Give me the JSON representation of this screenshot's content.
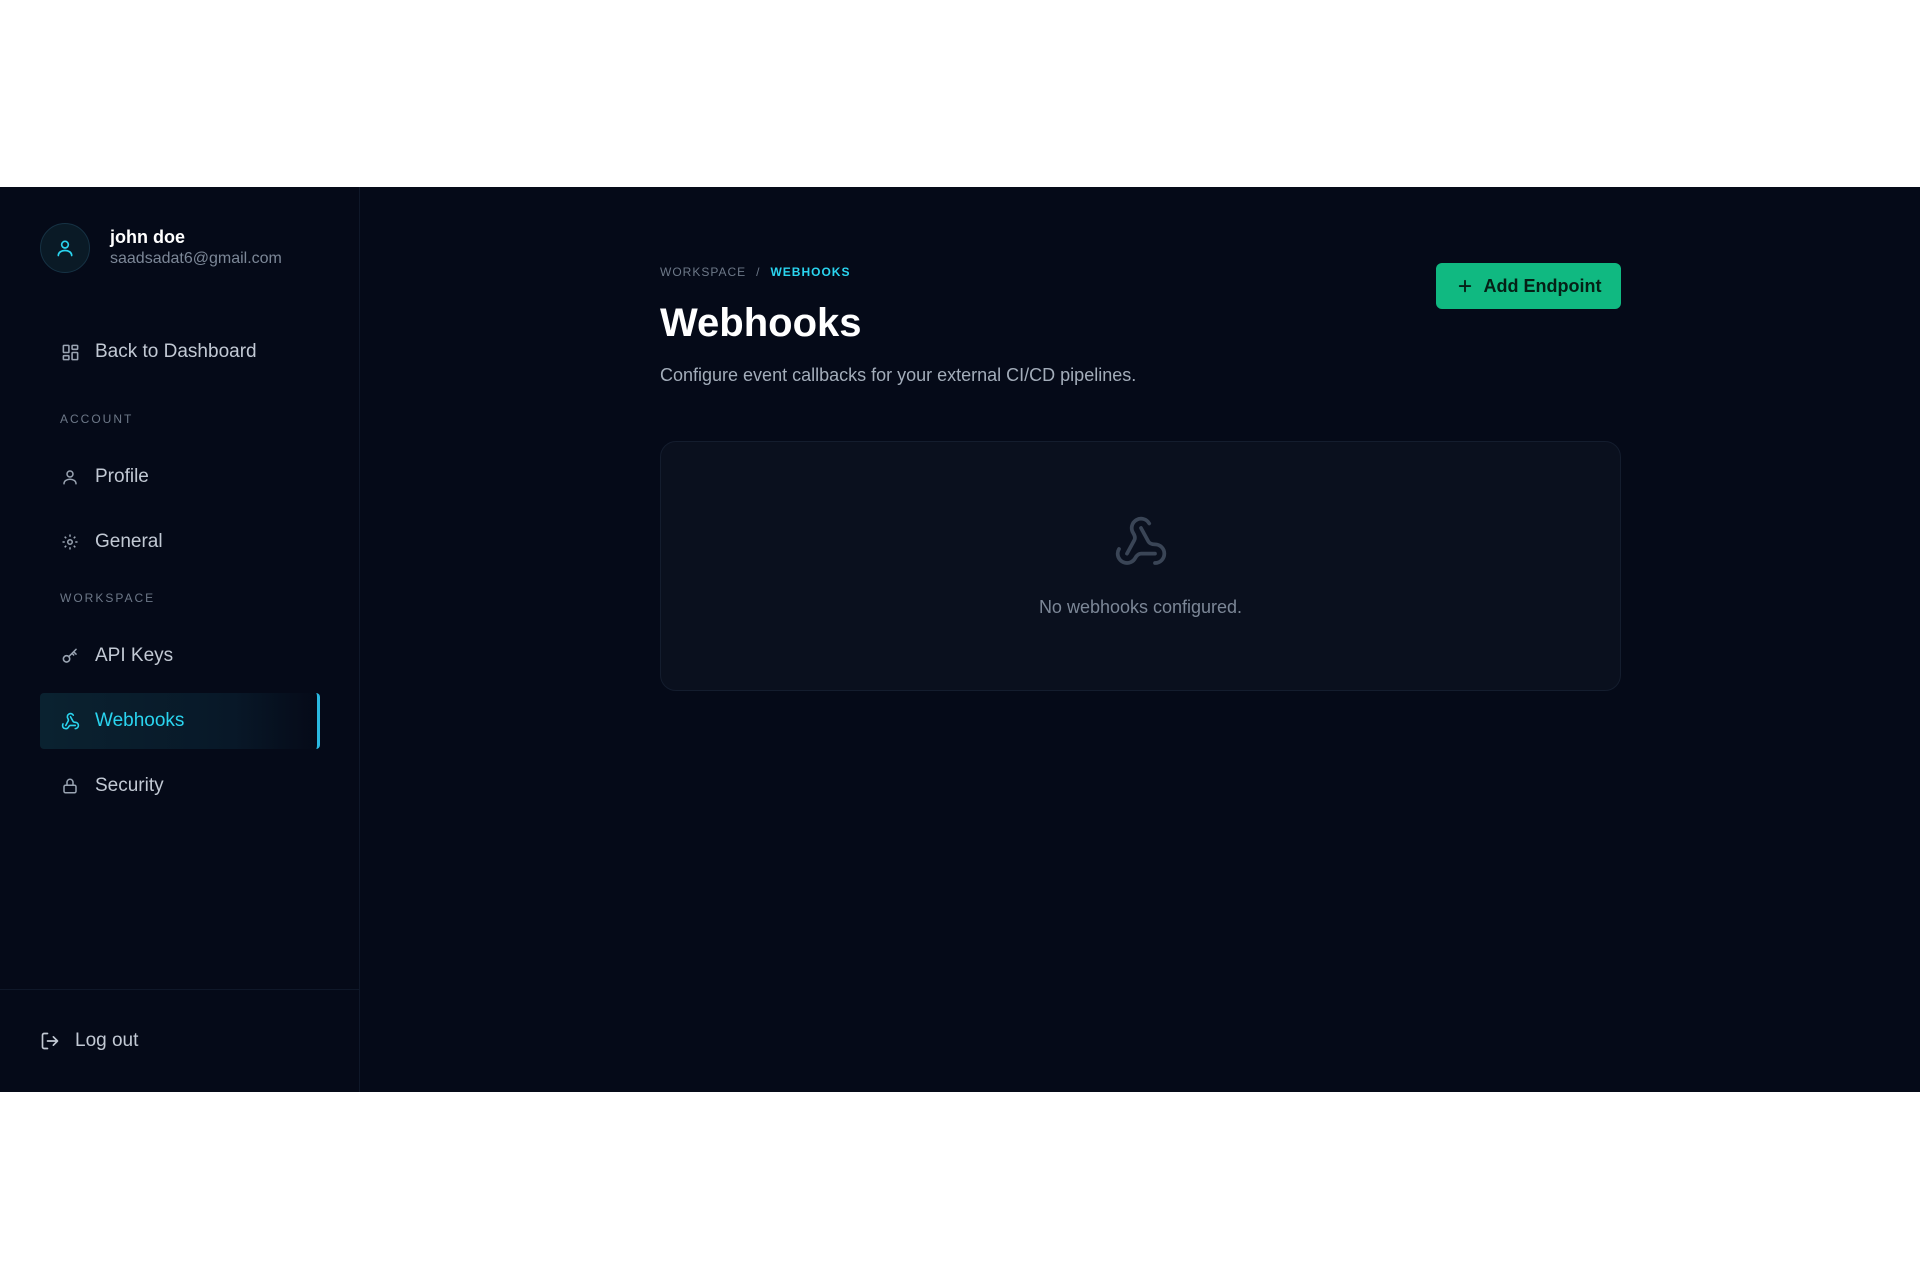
{
  "user": {
    "name": "john doe",
    "email": "saadsadat6@gmail.com"
  },
  "sidebar": {
    "back_label": "Back to Dashboard",
    "sections": {
      "account": "ACCOUNT",
      "workspace": "WORKSPACE"
    },
    "items": {
      "profile": "Profile",
      "general": "General",
      "api_keys": "API Keys",
      "webhooks": "Webhooks",
      "security": "Security"
    },
    "logout_label": "Log out"
  },
  "breadcrumb": {
    "root": "WORKSPACE",
    "separator": "/",
    "current": "WEBHOOKS"
  },
  "page": {
    "title": "Webhooks",
    "subtitle": "Configure event callbacks for your external CI/CD pipelines.",
    "add_button_label": "Add Endpoint",
    "empty_message": "No webhooks configured."
  },
  "colors": {
    "background": "#050a18",
    "accent": "#2ad4ef",
    "primary_button": "#10b981"
  },
  "icons": {
    "avatar": "user-icon",
    "back": "dashboard-grid-icon",
    "profile": "user-icon",
    "general": "gear-icon",
    "api_keys": "key-icon",
    "webhooks": "webhook-icon",
    "security": "lock-icon",
    "logout": "logout-icon",
    "add": "plus-icon"
  }
}
